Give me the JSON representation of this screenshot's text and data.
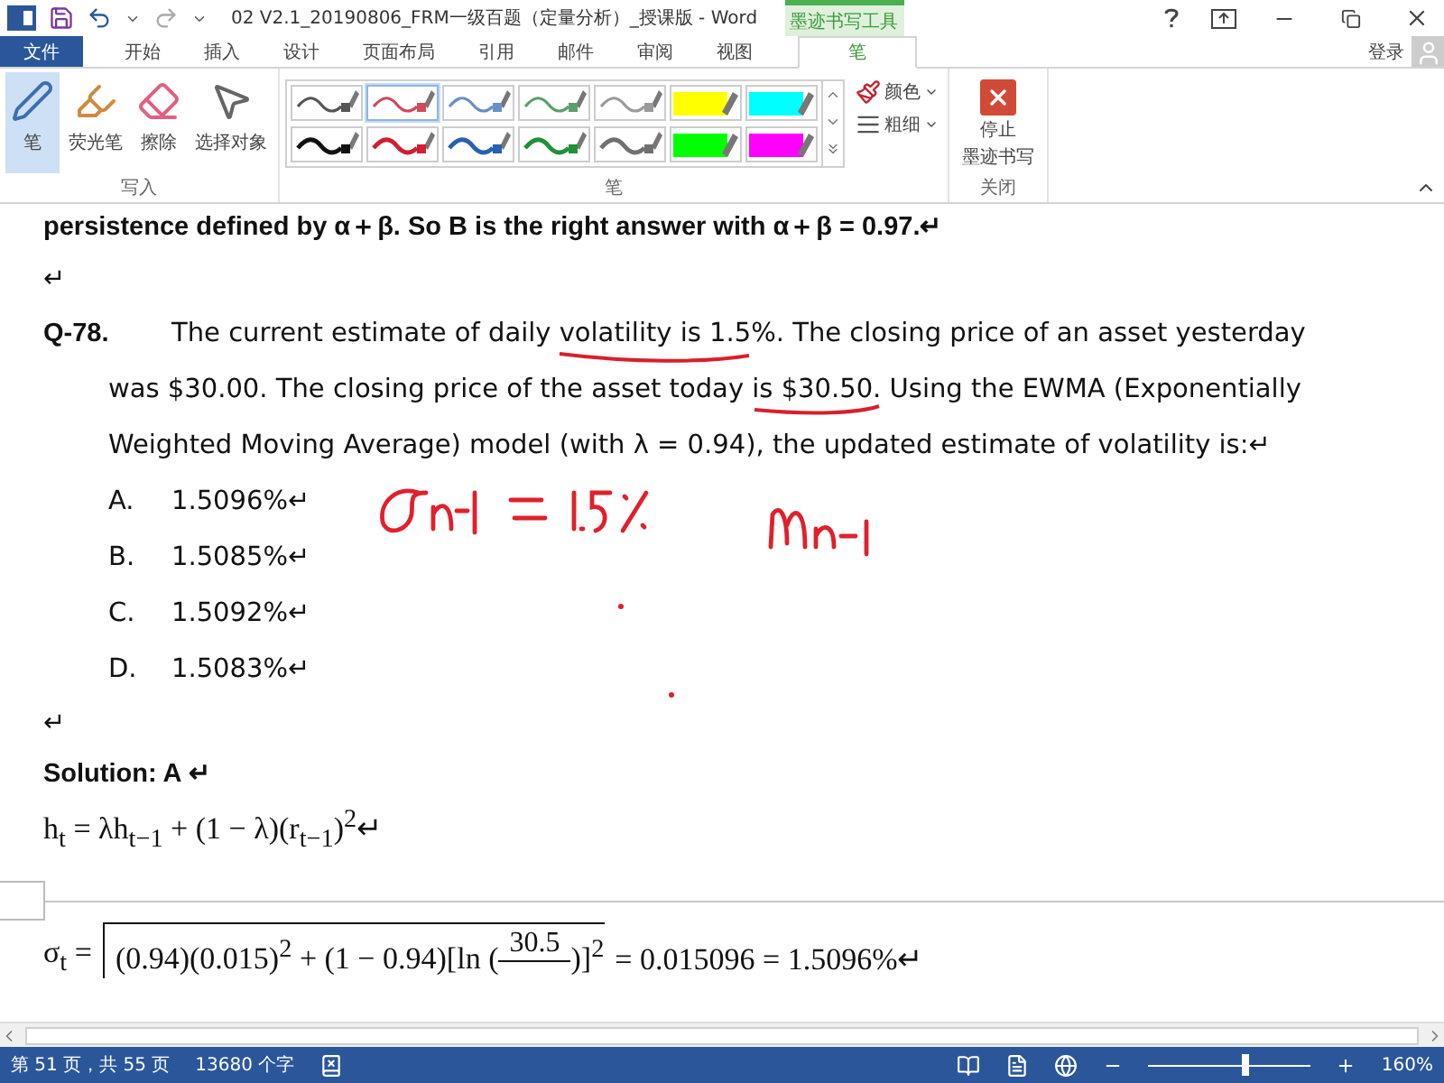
{
  "title_bar": {
    "title": "02 V2.1_20190806_FRM一级百题（定量分析）_授课版 - Word",
    "context_header": "墨迹书写工具"
  },
  "tabs": [
    {
      "label": "文件",
      "kind": "file",
      "selected": false
    },
    {
      "label": "开始",
      "kind": "tab",
      "selected": false
    },
    {
      "label": "插入",
      "kind": "tab",
      "selected": false
    },
    {
      "label": "设计",
      "kind": "tab",
      "selected": false
    },
    {
      "label": "页面布局",
      "kind": "tab",
      "selected": false
    },
    {
      "label": "引用",
      "kind": "tab",
      "selected": false
    },
    {
      "label": "邮件",
      "kind": "tab",
      "selected": false
    },
    {
      "label": "审阅",
      "kind": "tab",
      "selected": false
    },
    {
      "label": "视图",
      "kind": "tab",
      "selected": false
    },
    {
      "label": "笔",
      "kind": "context",
      "selected": true
    }
  ],
  "account": "登录",
  "write_group": {
    "label": "写入",
    "tools": [
      {
        "label": "笔",
        "kind": "pen",
        "selected": true
      },
      {
        "label": "荧光笔",
        "kind": "highlighter",
        "selected": false
      },
      {
        "label": "擦除",
        "kind": "eraser",
        "selected": false
      },
      {
        "label": "选择对象",
        "kind": "select",
        "selected": false
      }
    ]
  },
  "pens_group": {
    "label": "笔",
    "color_button": "颜色",
    "thickness_button": "粗细",
    "pens": [
      {
        "kind": "thin",
        "color": "#555555",
        "selected": false
      },
      {
        "kind": "thin",
        "color": "#d04a5a",
        "selected": true
      },
      {
        "kind": "thin",
        "color": "#6a8fc8",
        "selected": false
      },
      {
        "kind": "thin",
        "color": "#5aa06a",
        "selected": false
      },
      {
        "kind": "thin",
        "color": "#9a9a9a",
        "selected": false
      },
      {
        "kind": "highlighter",
        "color": "#ffff00",
        "selected": false
      },
      {
        "kind": "highlighter",
        "color": "#00ffff",
        "selected": false
      },
      {
        "kind": "thick",
        "color": "#111111",
        "selected": false
      },
      {
        "kind": "thick",
        "color": "#d02030",
        "selected": false
      },
      {
        "kind": "thick",
        "color": "#2a60b0",
        "selected": false
      },
      {
        "kind": "thick",
        "color": "#20903a",
        "selected": false
      },
      {
        "kind": "thick",
        "color": "#707070",
        "selected": false
      },
      {
        "kind": "highlighter",
        "color": "#00ff00",
        "selected": false
      },
      {
        "kind": "highlighter",
        "color": "#ff00ff",
        "selected": false
      }
    ]
  },
  "close_group": {
    "label": "关闭",
    "stop_button": [
      "停止",
      "墨迹书写"
    ]
  },
  "document": {
    "lines": [
      {
        "kind": "heading",
        "text": "persistence defined by α＋β. So B is the right answer with α＋β = 0.97.↵"
      },
      {
        "kind": "blank",
        "text": "↵"
      },
      {
        "kind": "question",
        "number": "Q-78.",
        "text": "The current estimate of daily volatility is 1.5%. The closing price of an asset yesterday"
      },
      {
        "kind": "continuation",
        "text": "was $30.00. The closing price of the asset today is $30.50. Using the EWMA (Exponentially"
      },
      {
        "kind": "continuation",
        "text": "Weighted Moving Average) model (with λ = 0.94), the updated estimate of volatility is:↵"
      },
      {
        "kind": "option",
        "letter": "A.",
        "text": "1.5096%↵"
      },
      {
        "kind": "option",
        "letter": "B.",
        "text": "1.5085%↵"
      },
      {
        "kind": "option",
        "letter": "C.",
        "text": "1.5092%↵"
      },
      {
        "kind": "option",
        "letter": "D.",
        "text": "1.5083%↵"
      },
      {
        "kind": "blank",
        "text": "↵"
      },
      {
        "kind": "heading",
        "text": "Solution: A ↵"
      },
      {
        "kind": "formula",
        "text": "h$_{t}$ = λh$_{t−1}$ + (1 − λ)(r$_{t−1}$)$^{2}$↵"
      }
    ],
    "sigma_formula": {
      "lhs": "σ$_{t}$ =",
      "radicand_before": "(0.94)(0.015)$^{2}$ + (1 − 0.94)[ln (",
      "numerator": "30.5",
      "radicand_after": ")]$^{2}$",
      "result": "= 0.015096 = 1.5096%↵"
    }
  },
  "status_bar": {
    "page": "第 51 页，共 55 页",
    "words": "13680 个字",
    "zoom": "160%",
    "zoom_slider": {
      "level": 0.6
    }
  }
}
